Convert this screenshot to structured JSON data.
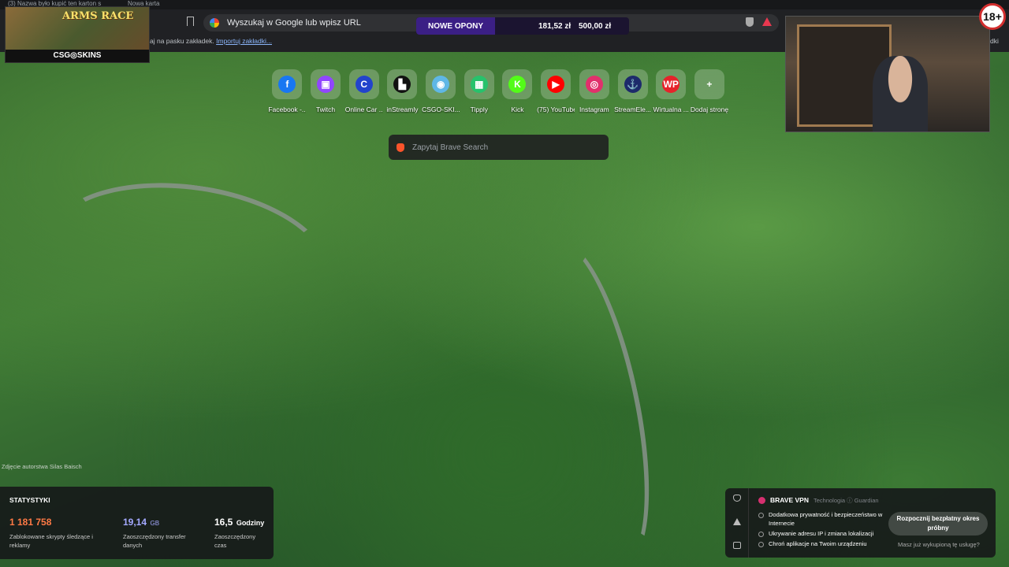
{
  "tabs": [
    "(3) Nazwa było kupić ten karton s",
    "Nowa karta"
  ],
  "address_bar": {
    "placeholder": "Wyszukaj w Google lub wpisz URL"
  },
  "bookmarks_bar": {
    "text": "aj na pasku zakładek.",
    "import_link": "Importuj zakładki...",
    "right_text": "dki"
  },
  "overlay_promo": {
    "label": "NOWE OPONY",
    "price1": "181,52 zł",
    "price2": "500,00 zł"
  },
  "stream_overlay": {
    "game_title": "ARMS RACE",
    "brand": "CSG◎SKINS",
    "age_badge": "18+"
  },
  "shortcuts": [
    {
      "label": "Facebook -...",
      "icon": "facebook-icon",
      "glyph": "f",
      "color": "#1877f2"
    },
    {
      "label": "Twitch",
      "icon": "twitch-icon",
      "glyph": "▣",
      "color": "#9146ff"
    },
    {
      "label": "Online Car ...",
      "icon": "online-car-icon",
      "glyph": "C",
      "color": "#2244cc"
    },
    {
      "label": "inStreamly",
      "icon": "instreamly-icon",
      "glyph": "▙",
      "color": "#111111"
    },
    {
      "label": "CSGO-SKI...",
      "icon": "csgo-skins-icon",
      "glyph": "◉",
      "color": "#5fb7e6"
    },
    {
      "label": "Tipply",
      "icon": "tipply-icon",
      "glyph": "▦",
      "color": "#27c26c"
    },
    {
      "label": "Kick",
      "icon": "kick-icon",
      "glyph": "K",
      "color": "#53fc18"
    },
    {
      "label": "(75) YouTube",
      "icon": "youtube-icon",
      "glyph": "▶",
      "color": "#ff0000"
    },
    {
      "label": "Instagram",
      "icon": "instagram-icon",
      "glyph": "◎",
      "color": "#e1306c"
    },
    {
      "label": "StreamEle...",
      "icon": "streamelements-icon",
      "glyph": "⚓",
      "color": "#1d2a6b"
    },
    {
      "label": "Wirtualna ...",
      "icon": "wp-icon",
      "glyph": "WP",
      "color": "#e6232b"
    },
    {
      "label": "Dodaj stronę",
      "icon": "add-icon",
      "glyph": "+",
      "color": "transparent"
    }
  ],
  "search": {
    "placeholder": "Zapytaj Brave Search"
  },
  "photo_credit": "Zdjęcie autorstwa Silas Baisch",
  "stats": {
    "title": "STATYSTYKI",
    "items": [
      {
        "value": "1 181 758",
        "unit": "",
        "desc": "Zablokowane skrypty śledzące i reklamy",
        "color": "#ff7a45"
      },
      {
        "value": "19,14",
        "unit": "GB",
        "desc": "Zaoszczędzony transfer danych",
        "color": "#a4a9ff"
      },
      {
        "value": "16,5",
        "unit": "Godziny",
        "desc": "Zaoszczędzony czas",
        "color": "#ffffff"
      }
    ]
  },
  "vpn": {
    "title": "BRAVE VPN",
    "tech": "Technologia ⓘ Guardian",
    "features": [
      "Dodatkowa prywatność i bezpieczeństwo w Internecie",
      "Ukrywanie adresu IP i zmiana lokalizacji",
      "Chroń aplikacje na Twoim urządzeniu"
    ],
    "button": "Rozpocznij bezpłatny okres próbny",
    "link": "Masz już wykupioną tę usługę?"
  }
}
